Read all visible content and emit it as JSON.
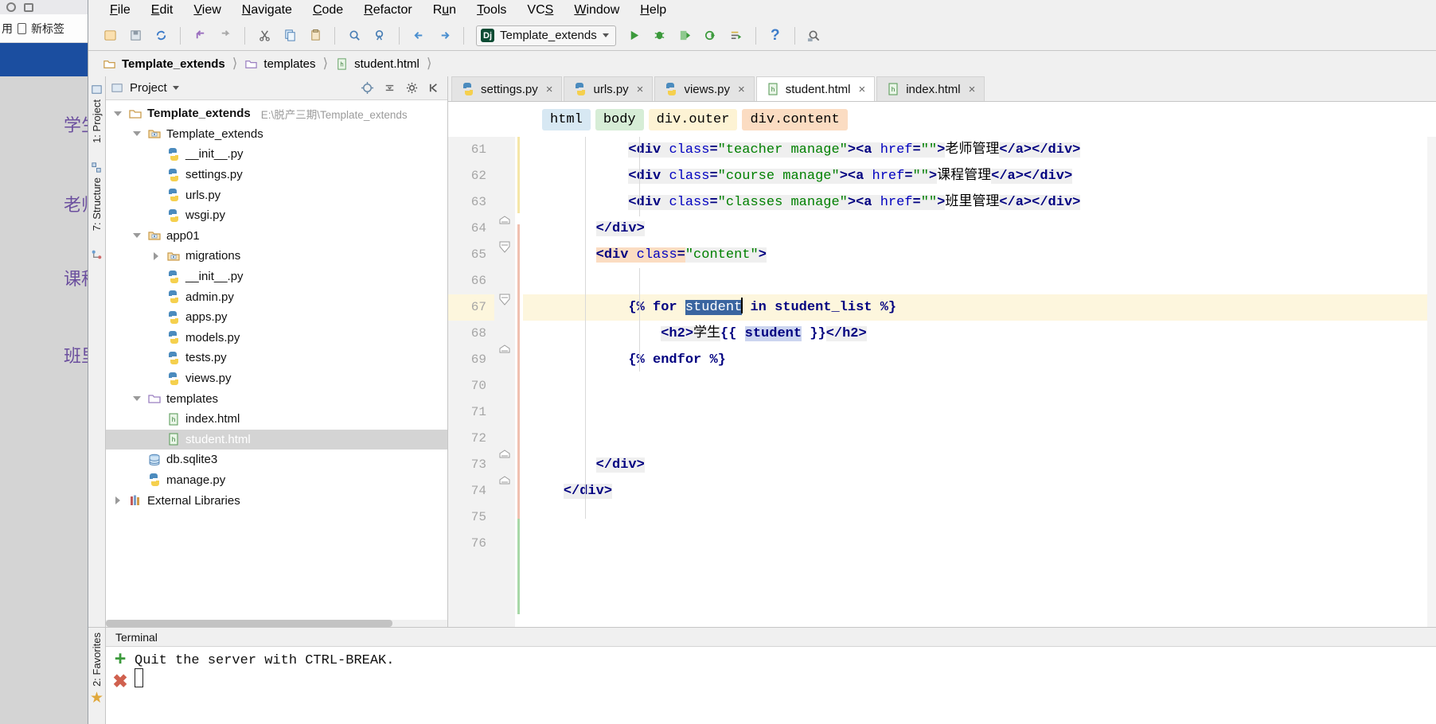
{
  "browser": {
    "bookmark_label": "用",
    "newtab_label": "新标签",
    "page_links": [
      "学生",
      "老师",
      "课程",
      "班里"
    ]
  },
  "menubar": {
    "items": [
      "File",
      "Edit",
      "View",
      "Navigate",
      "Code",
      "Refactor",
      "Run",
      "Tools",
      "VCS",
      "Window",
      "Help"
    ]
  },
  "toolbar": {
    "icons": [
      "new-file-icon",
      "save-all-icon",
      "sync-icon",
      "undo-icon",
      "redo-icon",
      "cut-icon",
      "copy-icon",
      "paste-icon",
      "find-icon",
      "find-replace-icon",
      "back-icon",
      "forward-icon"
    ],
    "run_config": "Template_extends",
    "run_label": "run-icon",
    "debug_label": "debug-icon",
    "coverage_label": "coverage-icon",
    "profile_label": "profile-icon",
    "attach_label": "attach-icon",
    "build_label": "build-icon",
    "help_label": "?",
    "search_everywhere_label": "search-everywhere-icon"
  },
  "breadcrumb": {
    "items": [
      {
        "label": "Template_extends",
        "icon": "folder-icon"
      },
      {
        "label": "templates",
        "icon": "folder-icon"
      },
      {
        "label": "student.html",
        "icon": "html-file-icon"
      }
    ]
  },
  "left_tool_strip": {
    "items": [
      "1: Project",
      "7: Structure"
    ]
  },
  "bottom_tool_strip": {
    "items": [
      "2: Favorites"
    ]
  },
  "project_panel": {
    "title": "Project",
    "tree": [
      {
        "label": "Template_extends",
        "note": "E:\\脱产三期\\Template_extends",
        "indent": 0,
        "twist": "down",
        "icon": "folder-icon",
        "bold": true,
        "selected": false
      },
      {
        "label": "Template_extends",
        "note": "",
        "indent": 1,
        "twist": "down",
        "icon": "module-folder-icon",
        "bold": false,
        "selected": false
      },
      {
        "label": "__init__.py",
        "note": "",
        "indent": 2,
        "twist": "none",
        "icon": "python-file-icon",
        "bold": false,
        "selected": false
      },
      {
        "label": "settings.py",
        "note": "",
        "indent": 2,
        "twist": "none",
        "icon": "python-file-icon",
        "bold": false,
        "selected": false
      },
      {
        "label": "urls.py",
        "note": "",
        "indent": 2,
        "twist": "none",
        "icon": "python-file-icon",
        "bold": false,
        "selected": false
      },
      {
        "label": "wsgi.py",
        "note": "",
        "indent": 2,
        "twist": "none",
        "icon": "python-file-icon",
        "bold": false,
        "selected": false
      },
      {
        "label": "app01",
        "note": "",
        "indent": 1,
        "twist": "down",
        "icon": "module-folder-icon",
        "bold": false,
        "selected": false
      },
      {
        "label": "migrations",
        "note": "",
        "indent": 2,
        "twist": "right",
        "icon": "module-folder-icon",
        "bold": false,
        "selected": false
      },
      {
        "label": "__init__.py",
        "note": "",
        "indent": 2,
        "twist": "none",
        "icon": "python-file-icon",
        "bold": false,
        "selected": false
      },
      {
        "label": "admin.py",
        "note": "",
        "indent": 2,
        "twist": "none",
        "icon": "python-file-icon",
        "bold": false,
        "selected": false
      },
      {
        "label": "apps.py",
        "note": "",
        "indent": 2,
        "twist": "none",
        "icon": "python-file-icon",
        "bold": false,
        "selected": false
      },
      {
        "label": "models.py",
        "note": "",
        "indent": 2,
        "twist": "none",
        "icon": "python-file-icon",
        "bold": false,
        "selected": false
      },
      {
        "label": "tests.py",
        "note": "",
        "indent": 2,
        "twist": "none",
        "icon": "python-file-icon",
        "bold": false,
        "selected": false
      },
      {
        "label": "views.py",
        "note": "",
        "indent": 2,
        "twist": "none",
        "icon": "python-file-icon",
        "bold": false,
        "selected": false
      },
      {
        "label": "templates",
        "note": "",
        "indent": 1,
        "twist": "down",
        "icon": "folder-purple-icon",
        "bold": false,
        "selected": false
      },
      {
        "label": "index.html",
        "note": "",
        "indent": 2,
        "twist": "none",
        "icon": "html-file-icon",
        "bold": false,
        "selected": false
      },
      {
        "label": "student.html",
        "note": "",
        "indent": 2,
        "twist": "none",
        "icon": "html-file-icon",
        "bold": false,
        "selected": true
      },
      {
        "label": "db.sqlite3",
        "note": "",
        "indent": 1,
        "twist": "none",
        "icon": "db-file-icon",
        "bold": false,
        "selected": false
      },
      {
        "label": "manage.py",
        "note": "",
        "indent": 1,
        "twist": "none",
        "icon": "python-file-icon",
        "bold": false,
        "selected": false
      },
      {
        "label": "External Libraries",
        "note": "",
        "indent": 0,
        "twist": "right",
        "icon": "libraries-icon",
        "bold": false,
        "selected": false
      }
    ]
  },
  "editor": {
    "tabs": [
      {
        "label": "settings.py",
        "icon": "python-file-icon",
        "active": false
      },
      {
        "label": "urls.py",
        "icon": "python-file-icon",
        "active": false
      },
      {
        "label": "views.py",
        "icon": "python-file-icon",
        "active": false
      },
      {
        "label": "student.html",
        "icon": "html-file-icon",
        "active": true
      },
      {
        "label": "index.html",
        "icon": "html-file-icon",
        "active": false
      }
    ],
    "structure_crumbs": [
      "html",
      "body",
      "div.outer",
      "div.content"
    ],
    "first_line_number": 61,
    "current_line": 67,
    "lines": [
      {
        "n": 61,
        "text": "            <div class=\"teacher manage\"><a href=\"\">老师管理</a></div>"
      },
      {
        "n": 62,
        "text": "            <div class=\"course manage\"><a href=\"\">课程管理</a></div>"
      },
      {
        "n": 63,
        "text": "            <div class=\"classes manage\"><a href=\"\">班里管理</a></div>"
      },
      {
        "n": 64,
        "text": "        </div>"
      },
      {
        "n": 65,
        "text": "        <div class=\"content\">"
      },
      {
        "n": 66,
        "text": ""
      },
      {
        "n": 67,
        "text": "            {% for student in student_list %}"
      },
      {
        "n": 68,
        "text": "                <h2>学生{{ student }}</h2>"
      },
      {
        "n": 69,
        "text": "            {% endfor %}"
      },
      {
        "n": 70,
        "text": ""
      },
      {
        "n": 71,
        "text": ""
      },
      {
        "n": 72,
        "text": ""
      },
      {
        "n": 73,
        "text": "        </div>"
      },
      {
        "n": 74,
        "text": "    </div>"
      },
      {
        "n": 75,
        "text": ""
      },
      {
        "n": 76,
        "text": ""
      }
    ],
    "selected_token": "student"
  },
  "terminal": {
    "title": "Terminal",
    "output": "Quit the server with CTRL-BREAK.",
    "new_session_icon": "plus-icon",
    "close_session_icon": "close-icon"
  },
  "colors": {
    "selection": "#3a65a0",
    "current_line": "#fdf6dd",
    "tag": "#000080",
    "string": "#008000",
    "attr": "#0000c0",
    "accent_blue": "#1b4ea0"
  }
}
